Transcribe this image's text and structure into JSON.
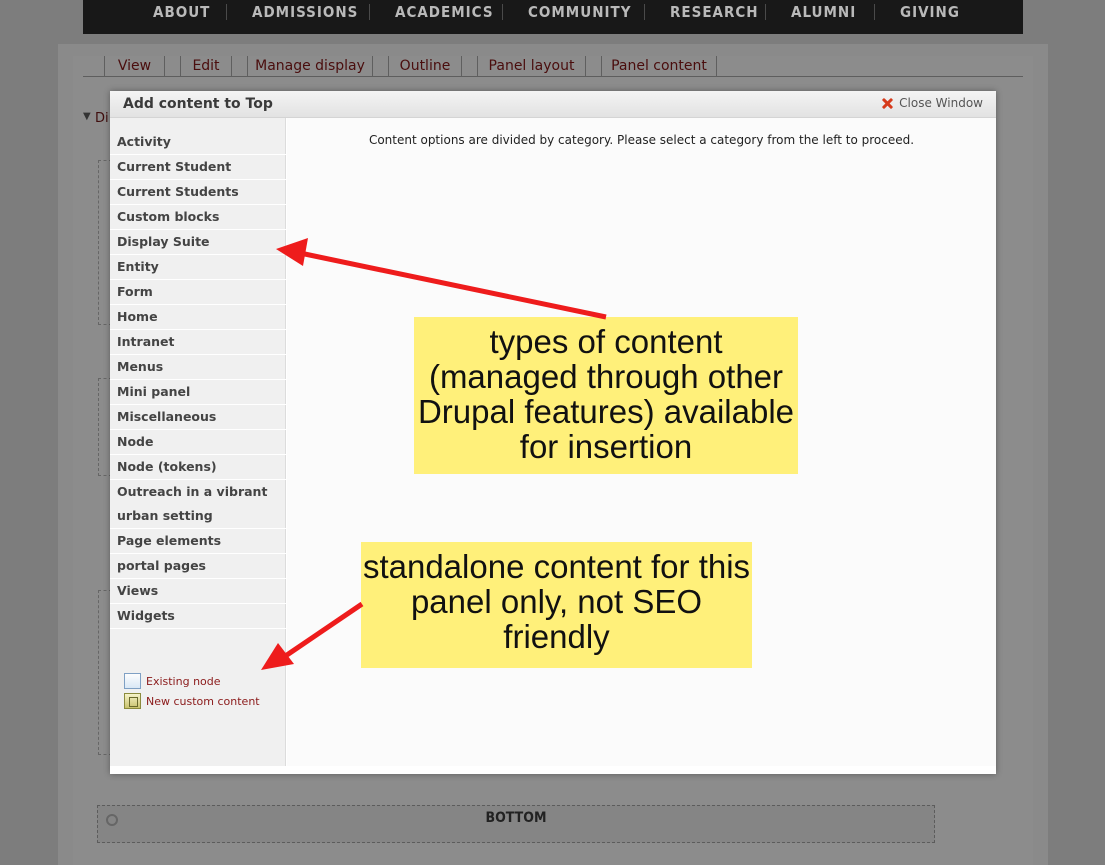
{
  "top_nav": {
    "items": [
      "ABOUT",
      "ADMISSIONS",
      "ACADEMICS",
      "COMMUNITY",
      "RESEARCH",
      "ALUMNI",
      "GIVING"
    ]
  },
  "tabs": [
    "View",
    "Edit",
    "Manage display",
    "Outline",
    "Panel layout",
    "Panel content"
  ],
  "background": {
    "fragment": "Di",
    "bottom_region": "BOTTOM"
  },
  "modal": {
    "title": "Add content to Top",
    "close_label": "Close Window",
    "instruction": "Content options are divided by category. Please select a category from the left to proceed.",
    "categories": [
      "Activity",
      "Current Student",
      "Current Students",
      "Custom blocks",
      "Display Suite",
      "Entity",
      "Form",
      "Home",
      "Intranet",
      "Menus",
      "Mini panel",
      "Miscellaneous",
      "Node",
      "Node (tokens)",
      "Outreach in a vibrant urban setting",
      "Page elements",
      "portal pages",
      "Views",
      "Widgets"
    ],
    "actions": {
      "existing_node": "Existing node",
      "new_custom_content": "New custom content"
    }
  },
  "annotations": {
    "callout_1": "types of content (managed through other Drupal features) available for insertion",
    "callout_2": "standalone content for this panel only, not SEO friendly",
    "arrow_color": "#ee1c1c",
    "callout_color": "#fff07a"
  }
}
